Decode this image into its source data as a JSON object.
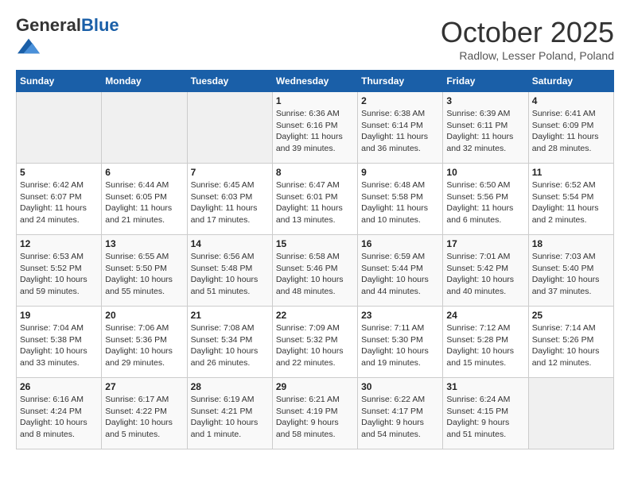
{
  "header": {
    "logo_general": "General",
    "logo_blue": "Blue",
    "month_title": "October 2025",
    "location": "Radlow, Lesser Poland, Poland"
  },
  "weekdays": [
    "Sunday",
    "Monday",
    "Tuesday",
    "Wednesday",
    "Thursday",
    "Friday",
    "Saturday"
  ],
  "weeks": [
    [
      {
        "day": "",
        "sunrise": "",
        "sunset": "",
        "daylight": ""
      },
      {
        "day": "",
        "sunrise": "",
        "sunset": "",
        "daylight": ""
      },
      {
        "day": "",
        "sunrise": "",
        "sunset": "",
        "daylight": ""
      },
      {
        "day": "1",
        "sunrise": "Sunrise: 6:36 AM",
        "sunset": "Sunset: 6:16 PM",
        "daylight": "Daylight: 11 hours and 39 minutes."
      },
      {
        "day": "2",
        "sunrise": "Sunrise: 6:38 AM",
        "sunset": "Sunset: 6:14 PM",
        "daylight": "Daylight: 11 hours and 36 minutes."
      },
      {
        "day": "3",
        "sunrise": "Sunrise: 6:39 AM",
        "sunset": "Sunset: 6:11 PM",
        "daylight": "Daylight: 11 hours and 32 minutes."
      },
      {
        "day": "4",
        "sunrise": "Sunrise: 6:41 AM",
        "sunset": "Sunset: 6:09 PM",
        "daylight": "Daylight: 11 hours and 28 minutes."
      }
    ],
    [
      {
        "day": "5",
        "sunrise": "Sunrise: 6:42 AM",
        "sunset": "Sunset: 6:07 PM",
        "daylight": "Daylight: 11 hours and 24 minutes."
      },
      {
        "day": "6",
        "sunrise": "Sunrise: 6:44 AM",
        "sunset": "Sunset: 6:05 PM",
        "daylight": "Daylight: 11 hours and 21 minutes."
      },
      {
        "day": "7",
        "sunrise": "Sunrise: 6:45 AM",
        "sunset": "Sunset: 6:03 PM",
        "daylight": "Daylight: 11 hours and 17 minutes."
      },
      {
        "day": "8",
        "sunrise": "Sunrise: 6:47 AM",
        "sunset": "Sunset: 6:01 PM",
        "daylight": "Daylight: 11 hours and 13 minutes."
      },
      {
        "day": "9",
        "sunrise": "Sunrise: 6:48 AM",
        "sunset": "Sunset: 5:58 PM",
        "daylight": "Daylight: 11 hours and 10 minutes."
      },
      {
        "day": "10",
        "sunrise": "Sunrise: 6:50 AM",
        "sunset": "Sunset: 5:56 PM",
        "daylight": "Daylight: 11 hours and 6 minutes."
      },
      {
        "day": "11",
        "sunrise": "Sunrise: 6:52 AM",
        "sunset": "Sunset: 5:54 PM",
        "daylight": "Daylight: 11 hours and 2 minutes."
      }
    ],
    [
      {
        "day": "12",
        "sunrise": "Sunrise: 6:53 AM",
        "sunset": "Sunset: 5:52 PM",
        "daylight": "Daylight: 10 hours and 59 minutes."
      },
      {
        "day": "13",
        "sunrise": "Sunrise: 6:55 AM",
        "sunset": "Sunset: 5:50 PM",
        "daylight": "Daylight: 10 hours and 55 minutes."
      },
      {
        "day": "14",
        "sunrise": "Sunrise: 6:56 AM",
        "sunset": "Sunset: 5:48 PM",
        "daylight": "Daylight: 10 hours and 51 minutes."
      },
      {
        "day": "15",
        "sunrise": "Sunrise: 6:58 AM",
        "sunset": "Sunset: 5:46 PM",
        "daylight": "Daylight: 10 hours and 48 minutes."
      },
      {
        "day": "16",
        "sunrise": "Sunrise: 6:59 AM",
        "sunset": "Sunset: 5:44 PM",
        "daylight": "Daylight: 10 hours and 44 minutes."
      },
      {
        "day": "17",
        "sunrise": "Sunrise: 7:01 AM",
        "sunset": "Sunset: 5:42 PM",
        "daylight": "Daylight: 10 hours and 40 minutes."
      },
      {
        "day": "18",
        "sunrise": "Sunrise: 7:03 AM",
        "sunset": "Sunset: 5:40 PM",
        "daylight": "Daylight: 10 hours and 37 minutes."
      }
    ],
    [
      {
        "day": "19",
        "sunrise": "Sunrise: 7:04 AM",
        "sunset": "Sunset: 5:38 PM",
        "daylight": "Daylight: 10 hours and 33 minutes."
      },
      {
        "day": "20",
        "sunrise": "Sunrise: 7:06 AM",
        "sunset": "Sunset: 5:36 PM",
        "daylight": "Daylight: 10 hours and 29 minutes."
      },
      {
        "day": "21",
        "sunrise": "Sunrise: 7:08 AM",
        "sunset": "Sunset: 5:34 PM",
        "daylight": "Daylight: 10 hours and 26 minutes."
      },
      {
        "day": "22",
        "sunrise": "Sunrise: 7:09 AM",
        "sunset": "Sunset: 5:32 PM",
        "daylight": "Daylight: 10 hours and 22 minutes."
      },
      {
        "day": "23",
        "sunrise": "Sunrise: 7:11 AM",
        "sunset": "Sunset: 5:30 PM",
        "daylight": "Daylight: 10 hours and 19 minutes."
      },
      {
        "day": "24",
        "sunrise": "Sunrise: 7:12 AM",
        "sunset": "Sunset: 5:28 PM",
        "daylight": "Daylight: 10 hours and 15 minutes."
      },
      {
        "day": "25",
        "sunrise": "Sunrise: 7:14 AM",
        "sunset": "Sunset: 5:26 PM",
        "daylight": "Daylight: 10 hours and 12 minutes."
      }
    ],
    [
      {
        "day": "26",
        "sunrise": "Sunrise: 6:16 AM",
        "sunset": "Sunset: 4:24 PM",
        "daylight": "Daylight: 10 hours and 8 minutes."
      },
      {
        "day": "27",
        "sunrise": "Sunrise: 6:17 AM",
        "sunset": "Sunset: 4:22 PM",
        "daylight": "Daylight: 10 hours and 5 minutes."
      },
      {
        "day": "28",
        "sunrise": "Sunrise: 6:19 AM",
        "sunset": "Sunset: 4:21 PM",
        "daylight": "Daylight: 10 hours and 1 minute."
      },
      {
        "day": "29",
        "sunrise": "Sunrise: 6:21 AM",
        "sunset": "Sunset: 4:19 PM",
        "daylight": "Daylight: 9 hours and 58 minutes."
      },
      {
        "day": "30",
        "sunrise": "Sunrise: 6:22 AM",
        "sunset": "Sunset: 4:17 PM",
        "daylight": "Daylight: 9 hours and 54 minutes."
      },
      {
        "day": "31",
        "sunrise": "Sunrise: 6:24 AM",
        "sunset": "Sunset: 4:15 PM",
        "daylight": "Daylight: 9 hours and 51 minutes."
      },
      {
        "day": "",
        "sunrise": "",
        "sunset": "",
        "daylight": ""
      }
    ]
  ]
}
